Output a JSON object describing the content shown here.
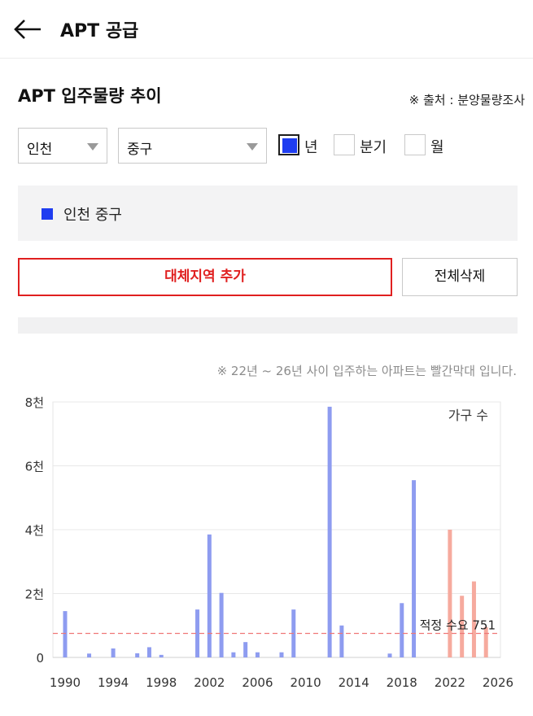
{
  "header": {
    "title": "APT 공급",
    "back_icon": "arrow-left-icon"
  },
  "section": {
    "title": "APT 입주물량 추이",
    "source": "※ 출처 : 분양물량조사"
  },
  "filters": {
    "region": "인천",
    "district": "중구",
    "periods": [
      {
        "label": "년",
        "checked": true
      },
      {
        "label": "분기",
        "checked": false
      },
      {
        "label": "월",
        "checked": false
      }
    ]
  },
  "legend": {
    "items": [
      {
        "label": "인천 중구",
        "color": "#1f3df0"
      }
    ]
  },
  "buttons": {
    "add_region": "대체지역 추가",
    "clear_all": "전체삭제"
  },
  "note": "※ 22년 ~ 26년 사이 입주하는 아파트는 빨간막대 입니다.",
  "colors": {
    "past_bar": "#8e9cf0",
    "future_bar": "#f6aa9e",
    "demand_line": "#ef7777",
    "accent": "#1f3df0"
  },
  "chart_data": {
    "type": "bar",
    "unit_label": "가구 수",
    "ylim": [
      0,
      8000
    ],
    "yticks": [
      {
        "value": 0,
        "label": "0"
      },
      {
        "value": 2000,
        "label": "2천"
      },
      {
        "value": 4000,
        "label": "4천"
      },
      {
        "value": 6000,
        "label": "6천"
      },
      {
        "value": 8000,
        "label": "8천"
      }
    ],
    "xlim": [
      1990,
      2026
    ],
    "xticks": [
      "1990",
      "1994",
      "1998",
      "2002",
      "2006",
      "2010",
      "2014",
      "2018",
      "2022",
      "2026"
    ],
    "series": [
      {
        "x": [
          1990,
          1992,
          1994,
          1996,
          1997,
          1998,
          2001,
          2002,
          2003,
          2004,
          2005,
          2006,
          2008,
          2009,
          2012,
          2013,
          2017,
          2018,
          2019
        ],
        "values": [
          1450,
          120,
          280,
          130,
          320,
          80,
          1500,
          3850,
          2020,
          160,
          480,
          160,
          160,
          1500,
          7850,
          1000,
          120,
          1700,
          5550
        ]
      },
      {
        "x": [
          2022,
          2023,
          2024,
          2025
        ],
        "values": [
          4000,
          1930,
          2380,
          950
        ]
      }
    ],
    "reference_line": {
      "value": 751,
      "label": "적정 수요 751"
    }
  }
}
